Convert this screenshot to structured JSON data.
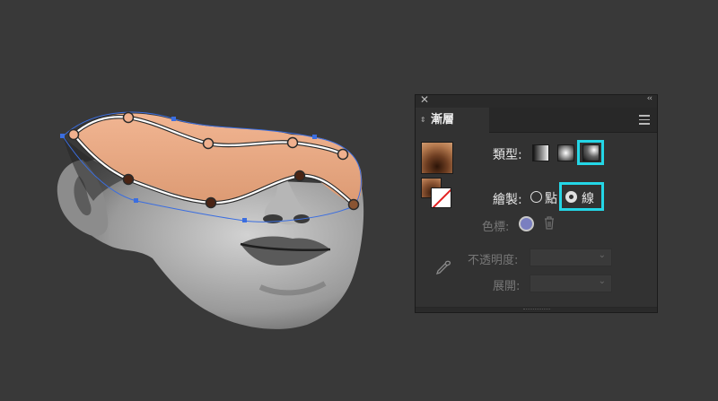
{
  "panel": {
    "tab_label": "漸層",
    "type_label": "類型:",
    "draw_label": "繪製:",
    "draw_option_points": "點",
    "draw_option_lines": "線",
    "color_stop_label": "色標:",
    "opacity_label": "不透明度:",
    "spread_label": "展開:",
    "close_glyph": "✕",
    "collapse_glyph": "‹‹",
    "sort_glyph": "⇕",
    "chevron_glyph": "⌄",
    "selected_type": "freeform",
    "selected_draw": "lines"
  },
  "colors": {
    "background": "#393939",
    "panel": "#323232",
    "highlight": "#24d6e6",
    "gradient_peach": "#e9a985",
    "anchor_blue": "#3b6ee0"
  },
  "icons": {
    "close": "close-icon",
    "collapse": "collapse-icon",
    "menu": "hamburger-menu-icon",
    "eyedropper": "eyedropper-icon",
    "trash": "trash-icon"
  }
}
